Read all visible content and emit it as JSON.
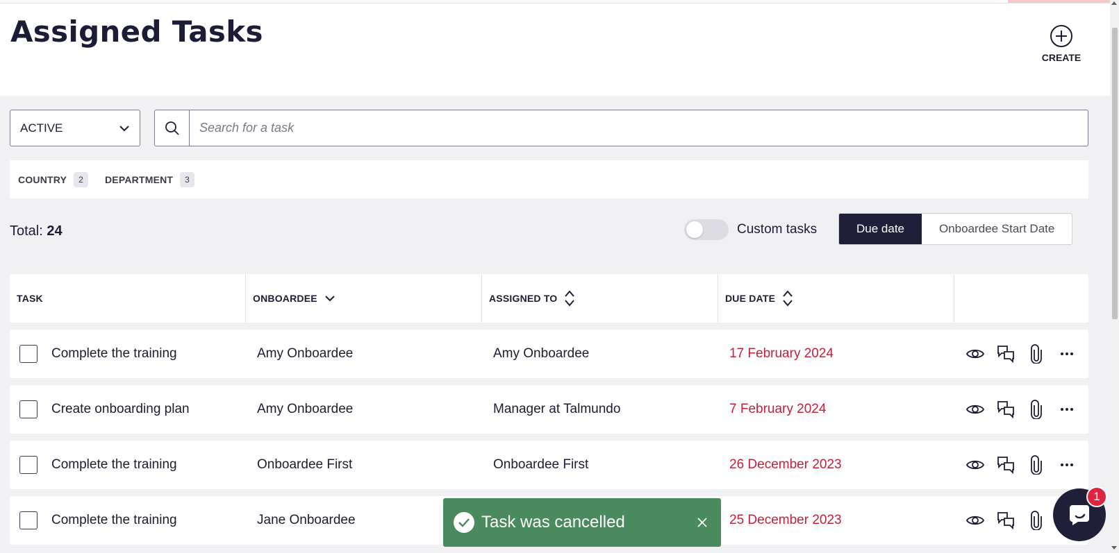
{
  "page": {
    "title": "Assigned Tasks"
  },
  "header": {
    "create_label": "CREATE"
  },
  "filters": {
    "status_select": "ACTIVE",
    "search_placeholder": "Search for a task",
    "chips": [
      {
        "label": "COUNTRY",
        "count": "2"
      },
      {
        "label": "DEPARTMENT",
        "count": "3"
      }
    ]
  },
  "summary": {
    "total_label": "Total:",
    "total_value": "24"
  },
  "toggle": {
    "label": "Custom tasks",
    "on": false
  },
  "sort": {
    "options": [
      "Due date",
      "Onboardee Start Date"
    ],
    "active": "Due date"
  },
  "table": {
    "columns": [
      "TASK",
      "ONBOARDEE",
      "ASSIGNED TO",
      "DUE DATE"
    ],
    "rows": [
      {
        "task": "Complete the training",
        "onboardee": "Amy Onboardee",
        "assigned_to": "Amy Onboardee",
        "due_date": "17 February 2024"
      },
      {
        "task": "Create onboarding plan",
        "onboardee": "Amy Onboardee",
        "assigned_to": "Manager at Talmundo",
        "due_date": "7 February 2024"
      },
      {
        "task": "Complete the training",
        "onboardee": "Onboardee First",
        "assigned_to": "Onboardee First",
        "due_date": "26 December 2023"
      },
      {
        "task": "Complete the training",
        "onboardee": "Jane Onboardee",
        "assigned_to": "",
        "due_date": "25 December 2023"
      }
    ]
  },
  "toast": {
    "message": "Task was cancelled"
  },
  "chat": {
    "badge": "1"
  },
  "colors": {
    "primary": "#1f1f3a",
    "overdue": "#c7203a",
    "toast": "#4b8a5e",
    "badge": "#e0243f"
  }
}
